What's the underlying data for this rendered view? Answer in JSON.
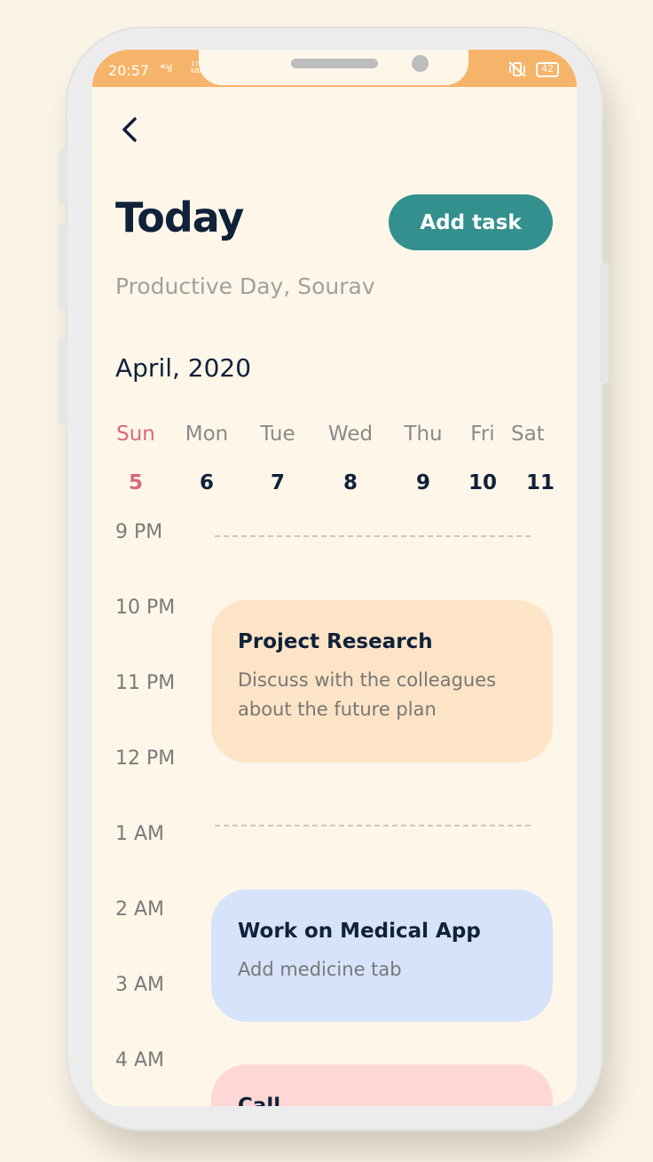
{
  "status": {
    "time": "20:57",
    "signal": "⁴ᴳıl",
    "net_speed": "17 KB/s",
    "battery": "42"
  },
  "header": {
    "back_icon": "chevron-left-icon",
    "title": "Today",
    "add_task_label": "Add task",
    "subtitle": "Productive Day, Sourav"
  },
  "calendar": {
    "month": "April, 2020",
    "days": [
      {
        "name": "Sun",
        "num": "5",
        "selected": true
      },
      {
        "name": "Mon",
        "num": "6"
      },
      {
        "name": "Tue",
        "num": "7"
      },
      {
        "name": "Wed",
        "num": "8"
      },
      {
        "name": "Thu",
        "num": "9"
      },
      {
        "name": "Fri",
        "num": "10"
      },
      {
        "name": "Sat",
        "num": "11"
      }
    ]
  },
  "timeline": {
    "hours": [
      "9 PM",
      "10 PM",
      "11 PM",
      "12 PM",
      "1 AM",
      "2 AM",
      "3 AM",
      "4 AM"
    ]
  },
  "tasks": [
    {
      "title": "Project Research",
      "description": "Discuss with the colleagues about the future plan",
      "color": "#fee4c6"
    },
    {
      "title": "Work on Medical App",
      "description": "Add medicine tab",
      "color": "#d6e3fb"
    },
    {
      "title": "Call",
      "description": "",
      "color": "#fed7d6"
    }
  ],
  "colors": {
    "accent": "#33908f",
    "selected_day": "#d9687a",
    "status_bar": "#f6b46a",
    "text_dark": "#10213a"
  }
}
